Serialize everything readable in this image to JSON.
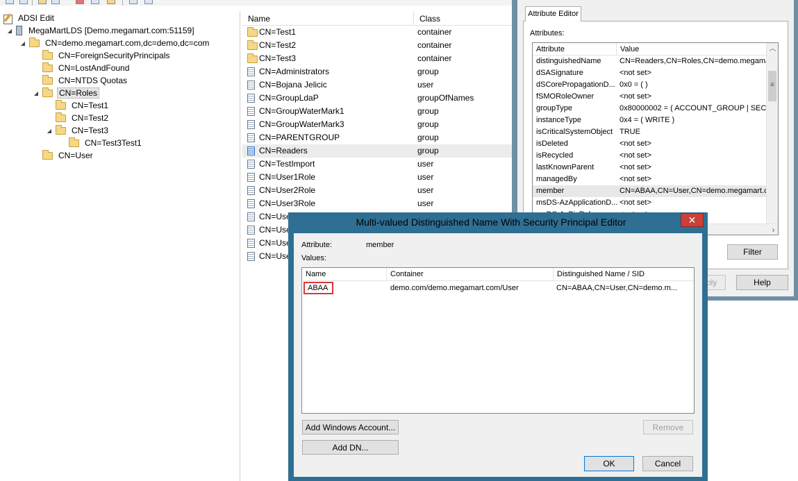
{
  "app": {
    "title": "ADSI Edit"
  },
  "tree": {
    "root": "ADSI Edit",
    "connection": "MegaMartLDS [Demo.megamart.com:51159]",
    "naming_context": "CN=demo.megamart.com,dc=demo,dc=com",
    "items": [
      {
        "label": "CN=ForeignSecurityPrincipals"
      },
      {
        "label": "CN=LostAndFound"
      },
      {
        "label": "CN=NTDS Quotas"
      },
      {
        "label": "CN=Roles"
      },
      {
        "label": "CN=Test1"
      },
      {
        "label": "CN=Test2"
      },
      {
        "label": "CN=Test3"
      },
      {
        "label": "CN=Test3Test1"
      },
      {
        "label": "CN=User"
      }
    ]
  },
  "list": {
    "headers": {
      "name": "Name",
      "class": "Class"
    },
    "rows": [
      {
        "name": "CN=Test1",
        "class": "container",
        "icon": "folder-icon"
      },
      {
        "name": "CN=Test2",
        "class": "container",
        "icon": "folder-icon"
      },
      {
        "name": "CN=Test3",
        "class": "container",
        "icon": "folder-icon"
      },
      {
        "name": "CN=Administrators",
        "class": "group",
        "icon": "object-icon"
      },
      {
        "name": "CN=Bojana Jelicic",
        "class": "user",
        "icon": "object-icon"
      },
      {
        "name": "CN=GroupLdaP",
        "class": "groupOfNames",
        "icon": "object-icon"
      },
      {
        "name": "CN=GroupWaterMark1",
        "class": "group",
        "icon": "object-icon"
      },
      {
        "name": "CN=GroupWaterMark3",
        "class": "group",
        "icon": "object-icon"
      },
      {
        "name": "CN=PARENTGROUP",
        "class": "group",
        "icon": "object-icon"
      },
      {
        "name": "CN=Readers",
        "class": "group",
        "icon": "object-icon"
      },
      {
        "name": "CN=TestImport",
        "class": "user",
        "icon": "object-icon"
      },
      {
        "name": "CN=User1Role",
        "class": "user",
        "icon": "object-icon"
      },
      {
        "name": "CN=User2Role",
        "class": "user",
        "icon": "object-icon"
      },
      {
        "name": "CN=User3Role",
        "class": "user",
        "icon": "object-icon"
      },
      {
        "name": "CN=Use",
        "class": "",
        "icon": "object-icon"
      },
      {
        "name": "CN=Use",
        "class": "",
        "icon": "object-icon"
      },
      {
        "name": "CN=Use",
        "class": "",
        "icon": "object-icon"
      },
      {
        "name": "CN=Use",
        "class": "",
        "icon": "object-icon"
      }
    ]
  },
  "properties": {
    "tab": "Attribute Editor",
    "attributes_label": "Attributes:",
    "headers": {
      "attribute": "Attribute",
      "value": "Value"
    },
    "rows": [
      {
        "attr": "distinguishedName",
        "value": "CN=Readers,CN=Roles,CN=demo.megamart"
      },
      {
        "attr": "dSASignature",
        "value": "<not set>"
      },
      {
        "attr": "dSCorePropagationD...",
        "value": "0x0 = ( )"
      },
      {
        "attr": "fSMORoleOwner",
        "value": "<not set>"
      },
      {
        "attr": "groupType",
        "value": "0x80000002 = ( ACCOUNT_GROUP | SECU"
      },
      {
        "attr": "instanceType",
        "value": "0x4 = ( WRITE )"
      },
      {
        "attr": "isCriticalSystemObject",
        "value": "TRUE"
      },
      {
        "attr": "isDeleted",
        "value": "<not set>"
      },
      {
        "attr": "isRecycled",
        "value": "<not set>"
      },
      {
        "attr": "lastKnownParent",
        "value": "<not set>"
      },
      {
        "attr": "managedBy",
        "value": "<not set>"
      },
      {
        "attr": "member",
        "value": "CN=ABAA,CN=User,CN=demo.megamart.co"
      },
      {
        "attr": "msDS-AzApplicationD...",
        "value": "<not set>"
      },
      {
        "attr": "msDS-AzBizRule",
        "value": "<not set>"
      }
    ],
    "filter_label": "Filter",
    "apply_label": "ply",
    "help_label": "Help"
  },
  "dialog": {
    "title": "Multi-valued Distinguished Name With Security Principal Editor",
    "close_glyph": "✕",
    "attribute_label": "Attribute:",
    "attribute_value": "member",
    "values_label": "Values:",
    "headers": {
      "name": "Name",
      "container": "Container",
      "dn": "Distinguished Name / SID"
    },
    "rows": [
      {
        "name": "ABAA",
        "container": "demo.com/demo.megamart.com/User",
        "dn": "CN=ABAA,CN=User,CN=demo.m..."
      }
    ],
    "buttons": {
      "add_windows": "Add Windows Account...",
      "add_dn": "Add DN...",
      "remove": "Remove",
      "ok": "OK",
      "cancel": "Cancel"
    }
  },
  "colors": {
    "dialog_frame": "#2f6f93",
    "close": "#c9413a",
    "highlight_box": "#d9373a",
    "props_frame": "#6e8fa4"
  }
}
